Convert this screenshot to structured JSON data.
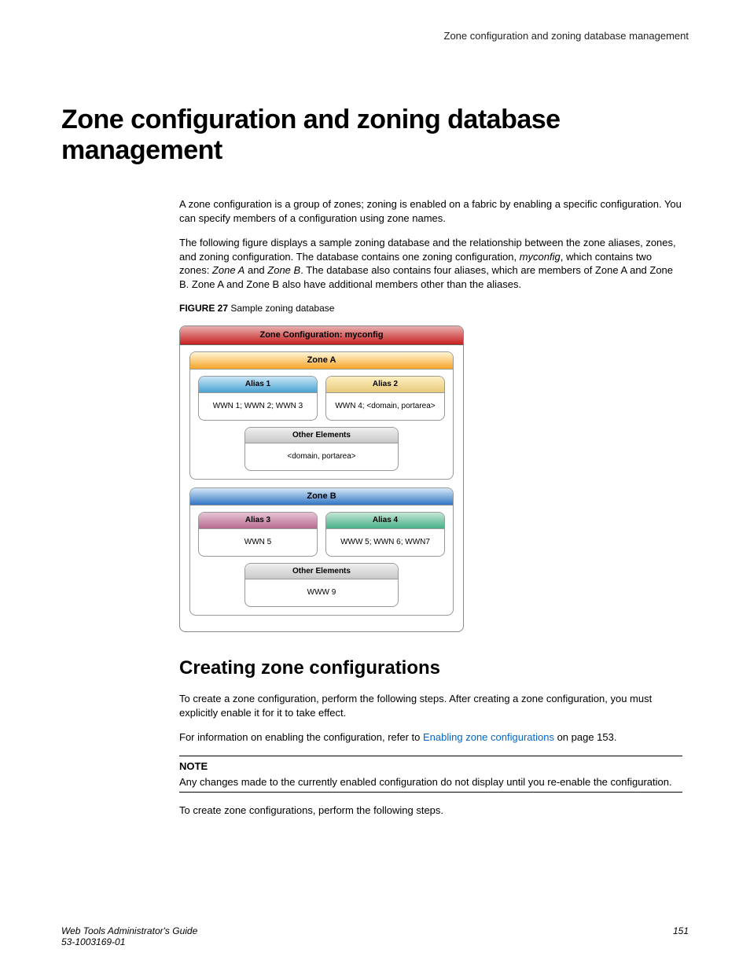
{
  "header": {
    "running": "Zone configuration and zoning database management"
  },
  "title": "Zone configuration and zoning database management",
  "para1": "A zone configuration is a group of zones; zoning is enabled on a fabric by enabling a specific configuration. You can specify members of a configuration using zone names.",
  "para2_a": "The following figure displays a sample zoning database and the relationship between the zone aliases, zones, and zoning configuration. The database contains one zoning configuration, ",
  "para2_config_name": "myconfig",
  "para2_b": ", which contains two zones: ",
  "para2_zone_a": "Zone A",
  "para2_and": " and ",
  "para2_zone_b": "Zone B",
  "para2_c": ". The database also contains four aliases, which are members of Zone A and Zone B. Zone A and Zone B also have additional members other than the aliases.",
  "figure": {
    "label": "FIGURE 27",
    "caption": " Sample zoning database"
  },
  "diagram": {
    "config_title": "Zone Configuration: myconfig",
    "zone_a": {
      "title": "Zone A",
      "alias1": {
        "title": "Alias 1",
        "body": "WWN 1; WWN 2; WWN 3"
      },
      "alias2": {
        "title": "Alias 2",
        "body": "WWN 4; <domain, portarea>"
      },
      "other_title": "Other Elements",
      "other_body": "<domain, portarea>"
    },
    "zone_b": {
      "title": "Zone B",
      "alias3": {
        "title": "Alias 3",
        "body": "WWN 5"
      },
      "alias4": {
        "title": "Alias 4",
        "body": "WWW 5; WWN 6; WWN7"
      },
      "other_title": "Other Elements",
      "other_body": "WWW 9"
    }
  },
  "subheading": "Creating zone configurations",
  "para3": "To create a zone configuration, perform the following steps. After creating a zone configuration, you must explicitly enable it for it to take effect.",
  "para4_a": "For information on enabling the configuration, refer to ",
  "para4_link": "Enabling zone configurations",
  "para4_b": " on page 153.",
  "note": {
    "heading": "NOTE",
    "body": "Any changes made to the currently enabled configuration do not display until you re-enable the configuration."
  },
  "para5": "To create zone configurations, perform the following steps.",
  "footer": {
    "guide": "Web Tools Administrator's Guide",
    "doc_num": "53-1003169-01",
    "page": "151"
  }
}
